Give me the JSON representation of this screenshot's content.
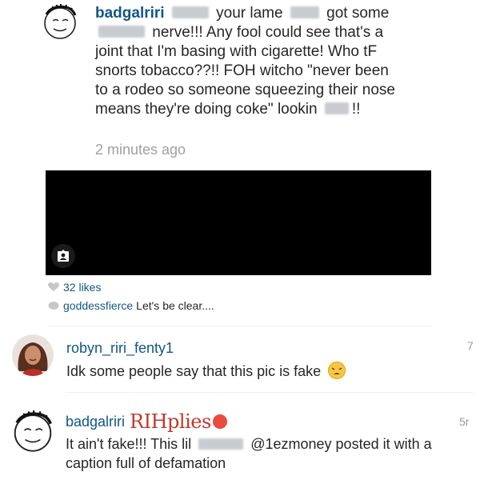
{
  "top_comment": {
    "username": "badgalriri",
    "text_1": "your lame",
    "text_2": "got some",
    "text_3": "nerve!!! Any fool could see that's a joint that I'm basing with cigarette! Who tF snorts tobacco??!! FOH witcho \"never been to a rodeo so someone squeezing their nose means they're doing coke\" lookin",
    "text_end": "!!",
    "time": "2 minutes ago"
  },
  "media": {
    "tag_icon": "person-tag-icon"
  },
  "likes": "32 likes",
  "caption": {
    "username": "goddessfierce",
    "text": "Let's be clear...."
  },
  "comment_2": {
    "username": "robyn_riri_fenty1",
    "body": "Idk some people say that this pic is fake",
    "age": "7",
    "emoji": "weary-face-icon"
  },
  "comment_3": {
    "username": "badgalriri",
    "watermark": "RIHplies",
    "body_1": "It ain't fake!!! This lil",
    "mention": "@1ezmoney",
    "body_2": "posted it with a caption full of defamation",
    "age": "5r"
  },
  "colors": {
    "username": "#125688",
    "timestamp": "#a0a0a0",
    "watermark": "#c0392b"
  }
}
